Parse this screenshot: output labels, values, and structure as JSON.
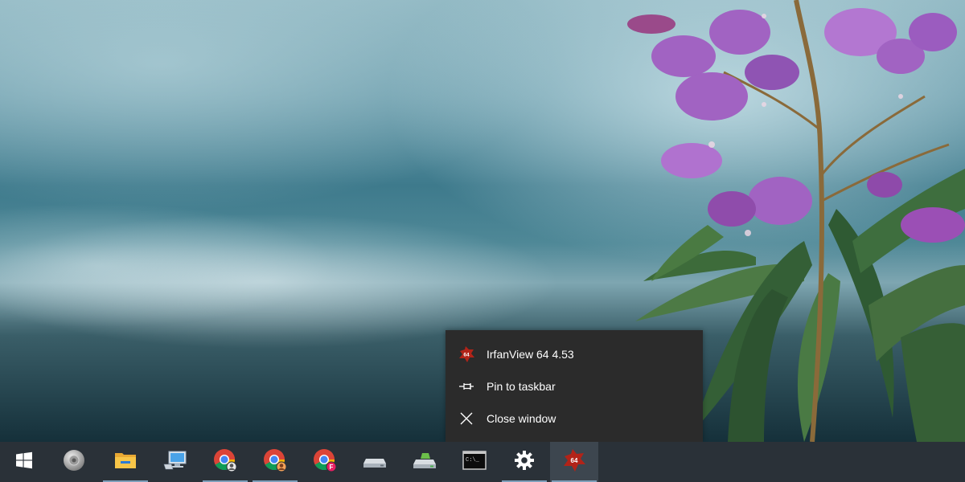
{
  "context_menu": {
    "items": [
      {
        "label": "IrfanView 64 4.53",
        "icon": "irfanview-icon"
      },
      {
        "label": "Pin to taskbar",
        "icon": "pin-icon"
      },
      {
        "label": "Close window",
        "icon": "close-icon"
      }
    ]
  },
  "taskbar": {
    "buttons": [
      {
        "name": "start-button",
        "icon": "windows-logo-icon",
        "running": false
      },
      {
        "name": "speaker-app-button",
        "icon": "speaker-icon",
        "running": false
      },
      {
        "name": "file-explorer-button",
        "icon": "folder-icon",
        "running": true
      },
      {
        "name": "this-pc-button",
        "icon": "computer-icon",
        "running": false
      },
      {
        "name": "chrome-profile-1-button",
        "icon": "chrome-icon",
        "running": true
      },
      {
        "name": "chrome-profile-2-button",
        "icon": "chrome-icon",
        "running": true
      },
      {
        "name": "chrome-profile-3-button",
        "icon": "chrome-icon",
        "running": false
      },
      {
        "name": "drive-button",
        "icon": "drive-icon",
        "running": false
      },
      {
        "name": "drive-2-button",
        "icon": "drive-green-icon",
        "running": false
      },
      {
        "name": "command-prompt-button",
        "icon": "terminal-icon",
        "running": false
      },
      {
        "name": "settings-button",
        "icon": "gear-icon",
        "running": true
      },
      {
        "name": "irfanview-button",
        "icon": "irfanview-icon",
        "running": true,
        "active": true
      }
    ],
    "irfanview_badge": "64",
    "cmd_prompt_glyph": "C:\\_",
    "chrome_badge_letter": "F",
    "colors": {
      "taskbar_bg": "#2a3138",
      "menu_bg": "#2b2b2b",
      "running_indicator": "#7e9fba"
    }
  }
}
